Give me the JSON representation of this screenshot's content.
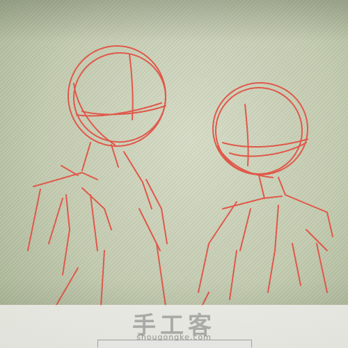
{
  "watermark": {
    "site_name": "手工客",
    "url": "shougongke.com"
  },
  "colors": {
    "sketch_stroke": "#e0584a",
    "screen": "#c9d0b8"
  }
}
